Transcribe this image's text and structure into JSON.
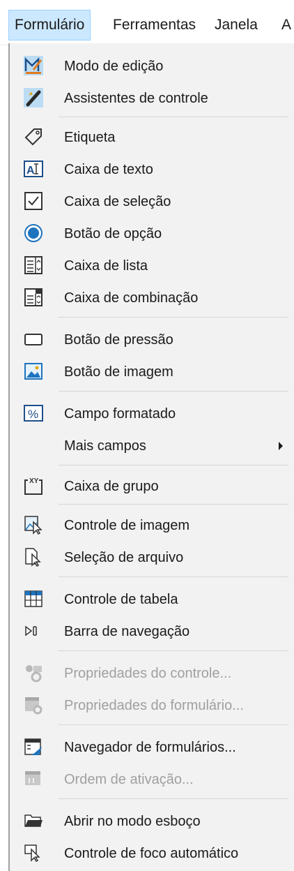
{
  "menubar": {
    "formulario": "Formulário",
    "ferramentas": "Ferramentas",
    "janela": "Janela",
    "ajuda_partial": "A"
  },
  "menu": {
    "modo_edicao": "Modo de edição",
    "assistentes": "Assistentes de controle",
    "etiqueta": "Etiqueta",
    "caixa_texto": "Caixa de texto",
    "caixa_selecao": "Caixa de seleção",
    "botao_opcao": "Botão de opção",
    "caixa_lista": "Caixa de lista",
    "caixa_combinacao": "Caixa de combinação",
    "botao_pressao": "Botão de pressão",
    "botao_imagem": "Botão de imagem",
    "campo_formatado": "Campo formatado",
    "mais_campos": "Mais campos",
    "caixa_grupo": "Caixa de grupo",
    "controle_imagem": "Controle de imagem",
    "selecao_arquivo": "Seleção de arquivo",
    "controle_tabela": "Controle de tabela",
    "barra_navegacao": "Barra de navegação",
    "propriedades_controle": "Propriedades do controle...",
    "propriedades_formulario": "Propriedades do formulário...",
    "navegador_formularios": "Navegador de formulários...",
    "ordem_ativacao": "Ordem de ativação...",
    "abrir_esboco": "Abrir no modo esboço",
    "controle_foco": "Controle de foco automático"
  },
  "colors": {
    "highlight": "#cce8ff",
    "menu_bg": "#f2f2f2",
    "disabled_text": "#a0a0a0",
    "accent": "#1e73be"
  }
}
